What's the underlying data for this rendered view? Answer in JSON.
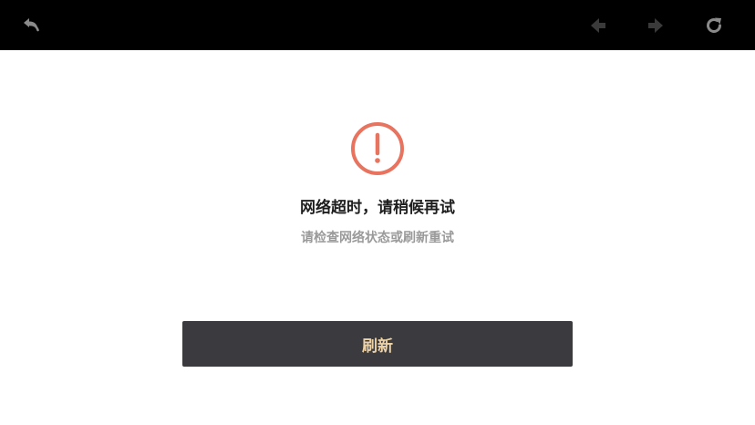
{
  "toolbar": {
    "icons": {
      "back": "back-arrow-icon",
      "prev": "previous-arrow-icon",
      "next": "next-arrow-icon",
      "reload": "reload-icon"
    },
    "icon_color": "#8a8a8a"
  },
  "error": {
    "icon": "exclamation-circle-icon",
    "icon_color": "#e8735f",
    "title": "网络超时，请稍候再试",
    "subtitle": "请检查网络状态或刷新重试"
  },
  "refresh_button": {
    "label": "刷新",
    "bg_color": "#3b3b3f",
    "text_color": "#ecd2a6"
  }
}
